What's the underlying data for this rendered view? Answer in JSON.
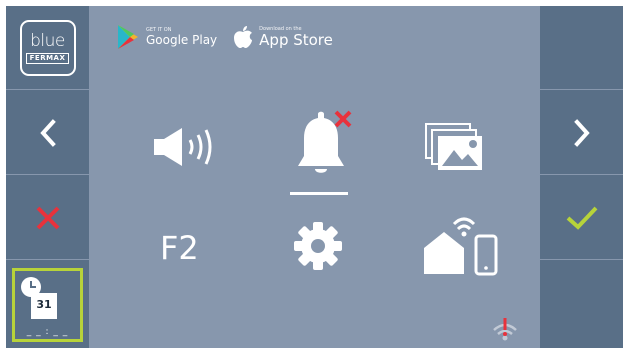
{
  "brand": {
    "logo_word": "blue",
    "logo_sub": "FERMAX"
  },
  "stores": {
    "google_small": "GET IT ON",
    "google_label": "Google Play",
    "apple_small": "Download on the",
    "apple_label": "App Store"
  },
  "menu": {
    "f2_label": "F2",
    "icons": [
      "speaker-volume-icon",
      "bell-muted-icon",
      "gallery-icon",
      "f2-button",
      "settings-gear-icon",
      "home-wifi-phone-icon"
    ]
  },
  "nav": {
    "left": "chevron-left-icon",
    "right": "chevron-right-icon",
    "cancel": "cross-icon",
    "confirm": "check-icon"
  },
  "datetime": {
    "day": "31",
    "time": "_ _ : _ _"
  },
  "colors": {
    "panel": "#596f87",
    "background": "#8797ad",
    "cancel": "#e8323c",
    "confirm": "#b7d33a",
    "alert": "#e8323c"
  }
}
